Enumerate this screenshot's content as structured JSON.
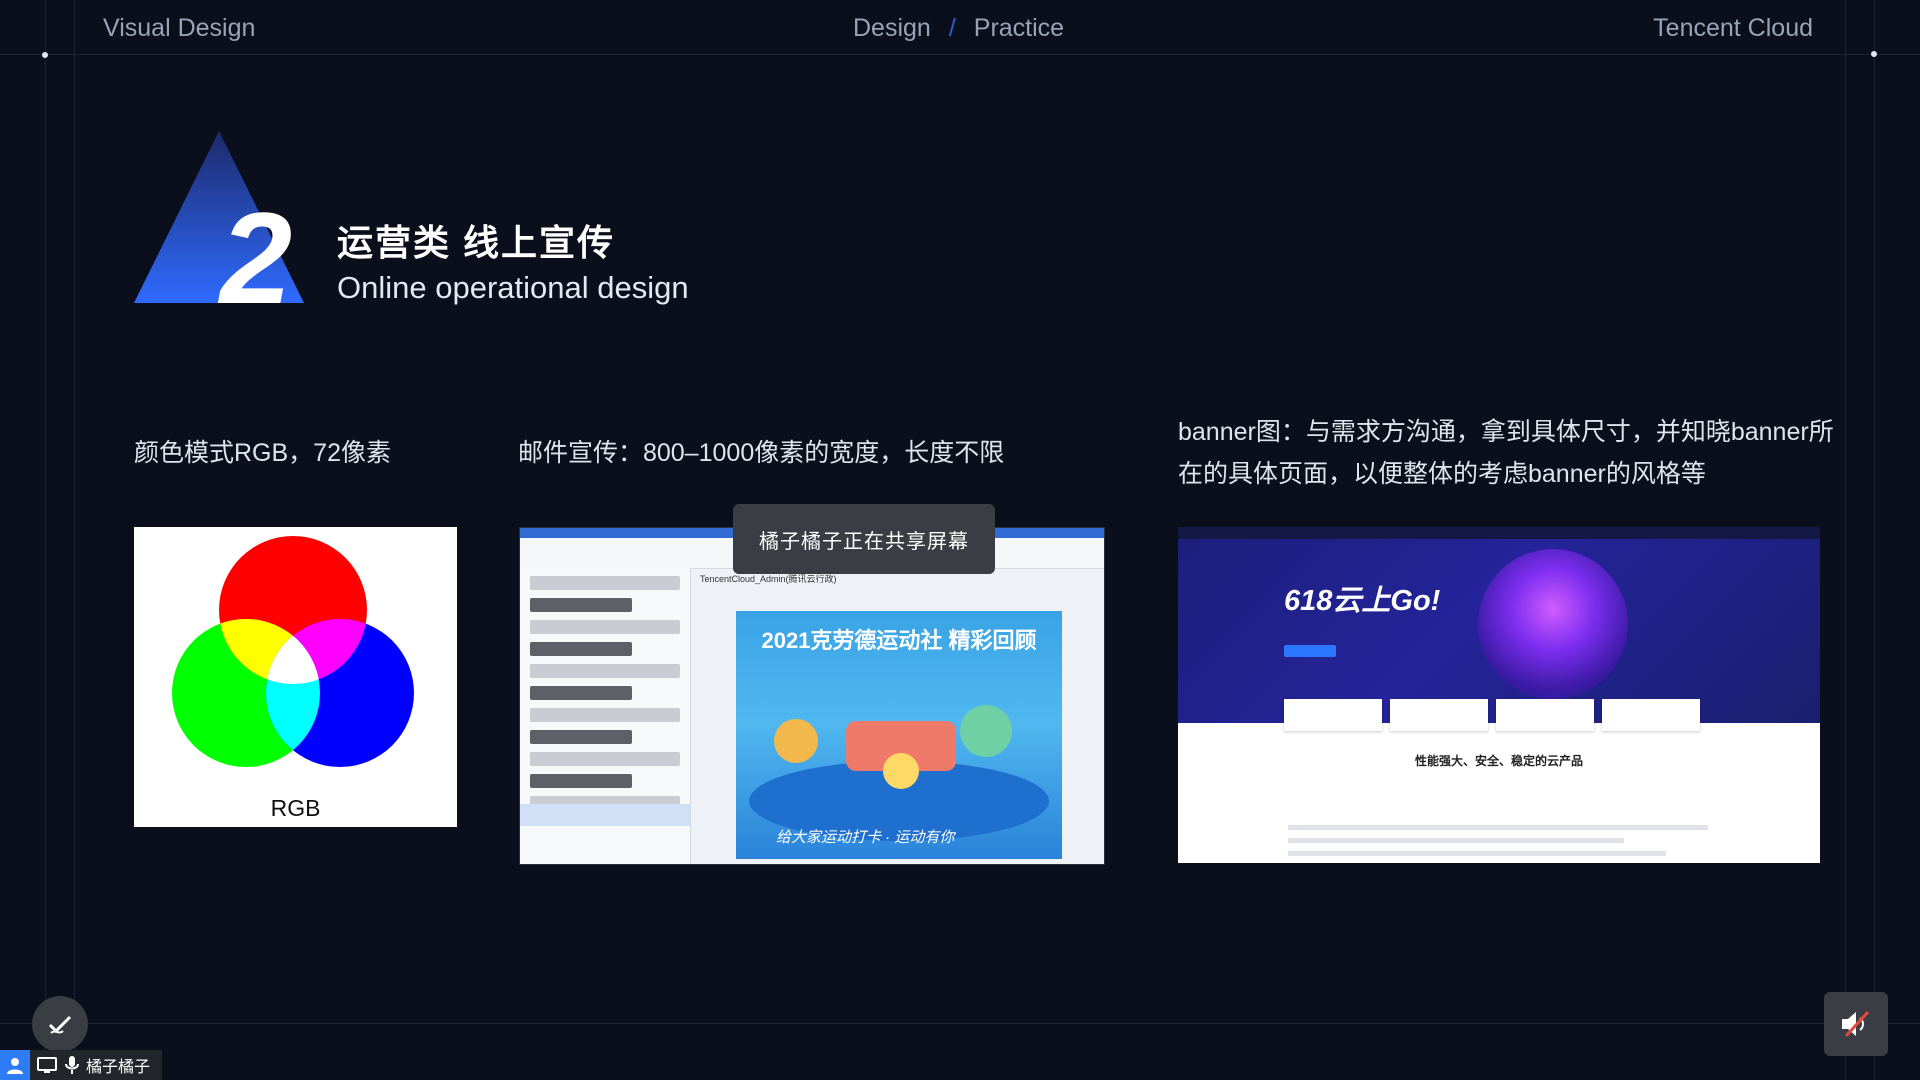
{
  "header": {
    "left": "Visual Design",
    "center_a": "Design",
    "center_sep": "/",
    "center_b": "Practice",
    "right": "Tencent Cloud"
  },
  "section": {
    "number": "2",
    "title_cn": "运营类 线上宣传",
    "title_en": "Online operational design"
  },
  "captions": {
    "rgb": "颜色模式RGB，72像素",
    "email": "邮件宣传：800–1000像素的宽度，长度不限",
    "banner": "banner图：与需求方沟通，拿到具体尺寸，并知晓banner所在的具体页面，以便整体的考虑banner的风格等"
  },
  "cards": {
    "rgb_label": "RGB",
    "mail_poster_title": "2021克劳德运动社 精彩回顾",
    "mail_poster_foot": "给大家运动打卡 · 运动有你",
    "mail_sender": "TencentCloud_Admin(腾讯云行政)",
    "banner_headline": "618云上Go!",
    "banner_subtitle": "性能强大、安全、稳定的云产品"
  },
  "overlay": {
    "share_toast": "橘子橘子正在共享屏幕",
    "presenter_name": "橘子橘子"
  },
  "icons": {
    "annotate": "pen-annotate-icon",
    "user": "user-icon",
    "screen": "screen-share-icon",
    "mic": "microphone-icon",
    "mute": "speaker-muted-icon"
  },
  "colors": {
    "background": "#0b0f1b",
    "accent": "#2e5bd8",
    "badge_gradient_top": "#1d2a6b",
    "badge_gradient_bottom": "#2f6bff"
  }
}
